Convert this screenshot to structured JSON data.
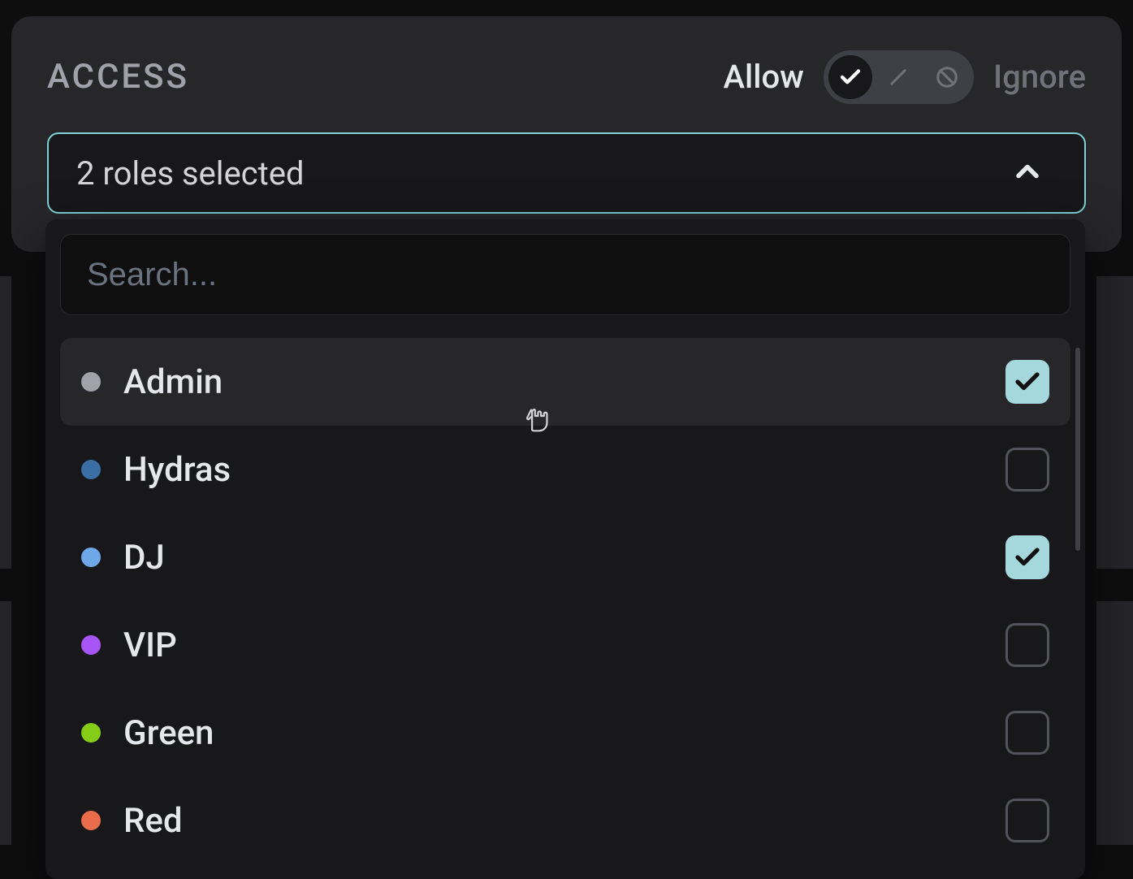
{
  "panel": {
    "title": "ACCESS",
    "allow_label": "Allow",
    "ignore_label": "Ignore",
    "toggle_state": "allow"
  },
  "select": {
    "summary": "2 roles selected"
  },
  "search": {
    "placeholder": "Search...",
    "value": ""
  },
  "roles": [
    {
      "name": "Admin",
      "color": "#a1a1aa",
      "checked": true,
      "hovered": true
    },
    {
      "name": "Hydras",
      "color": "#3b6ea5",
      "checked": false,
      "hovered": false
    },
    {
      "name": "DJ",
      "color": "#6ea8e8",
      "checked": true,
      "hovered": false
    },
    {
      "name": "VIP",
      "color": "#a855f7",
      "checked": false,
      "hovered": false
    },
    {
      "name": "Green",
      "color": "#84cc16",
      "checked": false,
      "hovered": false
    },
    {
      "name": "Red",
      "color": "#e86b4a",
      "checked": false,
      "hovered": false
    }
  ],
  "colors": {
    "checkbox_checked_bg": "#a5d8dc",
    "focus_ring": "#7dd3d8"
  }
}
